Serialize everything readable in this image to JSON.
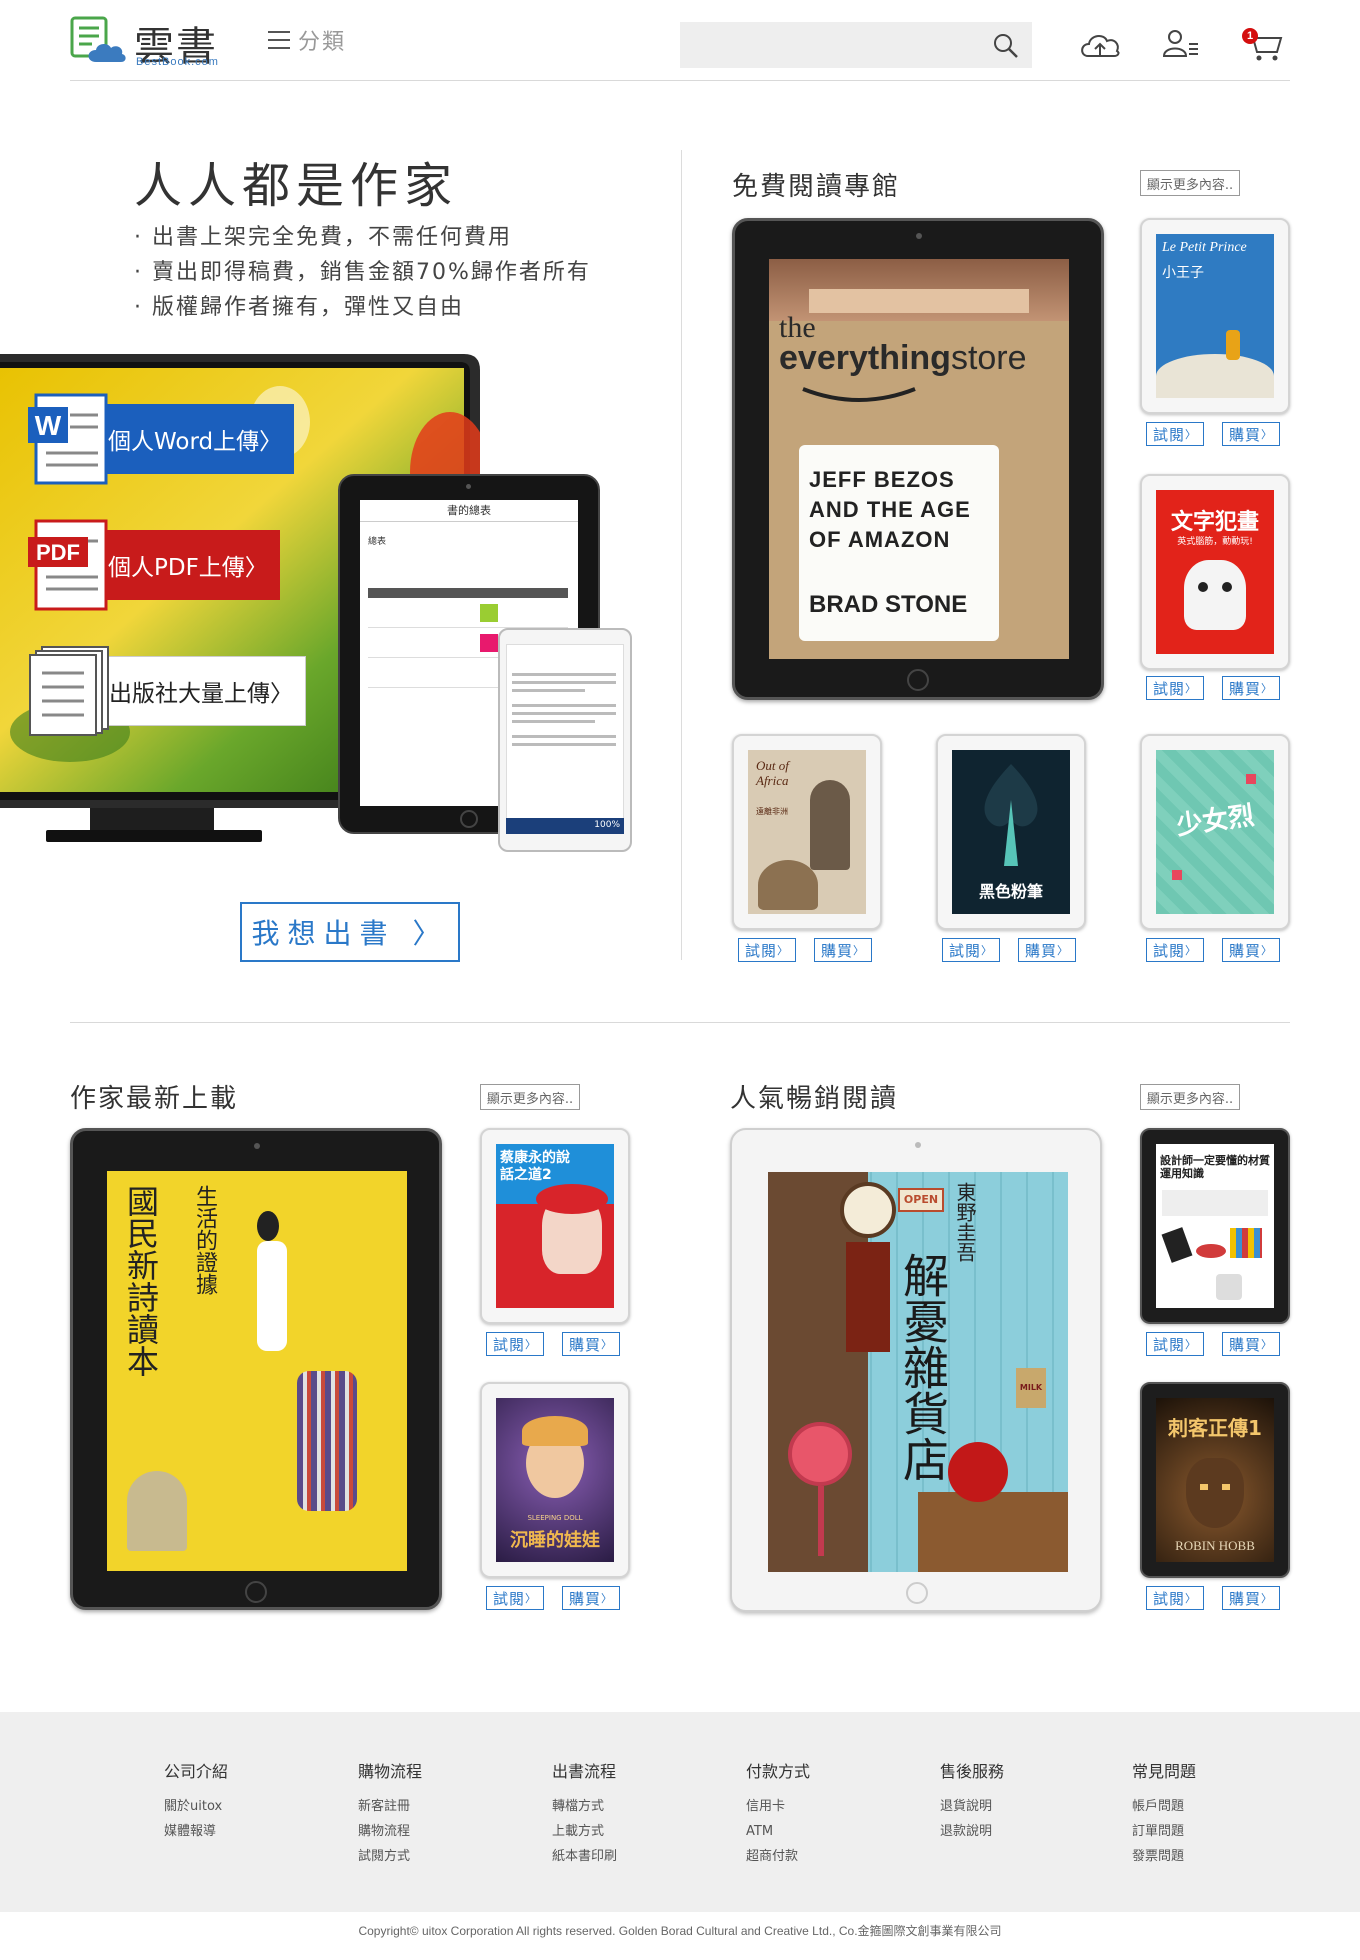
{
  "header": {
    "logo_cn": "雲書",
    "logo_en": "BestBook.com",
    "category_label": "分類",
    "search_placeholder": "",
    "cart_count": "1"
  },
  "hero": {
    "title": "人人都是作家",
    "bullets": [
      "出書上架完全免費，不需任何費用",
      "賣出即得稿費，銷售金額70%歸作者所有",
      "版權歸作者擁有，彈性又自由"
    ],
    "upload_word": "個人Word上傳〉",
    "upload_pdf": "個人PDF上傳〉",
    "upload_pub": "出版社大量上傳〉",
    "publish_button": "我想出書 〉",
    "tablet_title": "書的總表",
    "tablet_tab": "總表",
    "phone_progress": "100%"
  },
  "sections": {
    "free": {
      "title": "免費閱讀專館",
      "more": "顯示更多內容..",
      "featured": {
        "line1": "the",
        "line2": "everything",
        "line3": "store",
        "subtitle": [
          "JEFF BEZOS",
          "AND THE AGE",
          "OF AMAZON"
        ],
        "author": "BRAD STONE"
      },
      "books": [
        {
          "title": "小王子",
          "subtitle": "Le Petit Prince"
        },
        {
          "title": "文字犯畫",
          "subtitle": "英式腦筋，動動玩!"
        },
        {
          "title": "Out of Africa",
          "subtitle": "遠離非洲"
        },
        {
          "title": "黑色粉筆",
          "subtitle": ""
        },
        {
          "title": "少女烈",
          "subtitle": ""
        }
      ]
    },
    "new": {
      "title": "作家最新上載",
      "more": "顯示更多內容..",
      "featured": {
        "title": "國民新詩讀本",
        "subtitle": "生活的證據"
      },
      "books": [
        {
          "title": "蔡康永的說話之道2",
          "subtitle": ""
        },
        {
          "title": "沉睡的娃娃",
          "subtitle": "SLEEPING DOLL"
        }
      ]
    },
    "popular": {
      "title": "人氣暢銷閱讀",
      "more": "顯示更多內容..",
      "featured": {
        "author": "東野圭吾",
        "title": "解憂雜貨店",
        "sign": "OPEN",
        "milk": "MILK"
      },
      "books": [
        {
          "title": "設計師一定要懂的材質運用知識",
          "subtitle": ""
        },
        {
          "title": "刺客正傳1",
          "subtitle": "ROBIN HOBB"
        }
      ]
    }
  },
  "actions": {
    "preview": "試閱",
    "buy": "購買"
  },
  "footer": {
    "columns": [
      {
        "title": "公司介紹",
        "links": [
          "關於uitox",
          "媒體報導"
        ]
      },
      {
        "title": "購物流程",
        "links": [
          "新客註冊",
          "購物流程",
          "試閱方式"
        ]
      },
      {
        "title": "出書流程",
        "links": [
          "轉檔方式",
          "上載方式",
          "紙本書印刷"
        ]
      },
      {
        "title": "付款方式",
        "links": [
          "信用卡",
          "ATM",
          "超商付款"
        ]
      },
      {
        "title": "售後服務",
        "links": [
          "退貨說明",
          "退款說明"
        ]
      },
      {
        "title": "常見問題",
        "links": [
          "帳戶問題",
          "訂單問題",
          "發票問題"
        ]
      }
    ],
    "copyright": "Copyright© uitox Corporation  All rights reserved.   Golden Borad Cultural and Creative Ltd., Co.金箍圖際文創事業有限公司"
  },
  "colors": {
    "accent": "#2a78c8",
    "word_blue": "#1b5fbd",
    "pdf_red": "#c81b1b",
    "badge_red": "#d40e0e"
  }
}
